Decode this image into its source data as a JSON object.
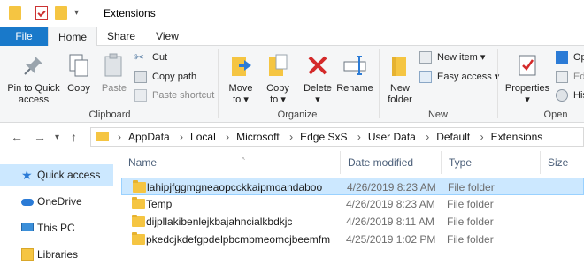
{
  "window": {
    "title": "Extensions"
  },
  "tabs": {
    "file": "File",
    "home": "Home",
    "share": "Share",
    "view": "View"
  },
  "ribbon": {
    "clipboard": {
      "pin": [
        "Pin to Quick",
        "access"
      ],
      "copy": "Copy",
      "paste": "Paste",
      "cut": "Cut",
      "copy_path": "Copy path",
      "paste_shortcut": "Paste shortcut",
      "group": "Clipboard"
    },
    "organize": {
      "move_to": [
        "Move",
        "to ▾"
      ],
      "copy_to": [
        "Copy",
        "to ▾"
      ],
      "delete": [
        "Delete",
        "▾"
      ],
      "rename": "Rename",
      "group": "Organize"
    },
    "new": {
      "new_folder": [
        "New",
        "folder"
      ],
      "new_item": "New item ▾",
      "easy_access": "Easy access ▾",
      "group": "New"
    },
    "open": {
      "properties": [
        "Properties",
        "▾"
      ],
      "open": "Op",
      "edit": "Edi",
      "history": "His",
      "group": "Open"
    }
  },
  "address": {
    "crumbs": [
      "AppData",
      "Local",
      "Microsoft",
      "Edge SxS",
      "User Data",
      "Default",
      "Extensions"
    ]
  },
  "nav": {
    "items": [
      "Quick access",
      "OneDrive",
      "This PC",
      "Libraries"
    ]
  },
  "columns": {
    "name": "Name",
    "date": "Date modified",
    "type": "Type",
    "size": "Size"
  },
  "files": [
    {
      "name": "lahipjfggmgneaopcckkaipmoandaboo",
      "date": "4/26/2019 8:23 AM",
      "type": "File folder"
    },
    {
      "name": "Temp",
      "date": "4/26/2019 8:23 AM",
      "type": "File folder"
    },
    {
      "name": "dijpllakibenlejkbajahncialkbdkjc",
      "date": "4/26/2019 8:11 AM",
      "type": "File folder"
    },
    {
      "name": "pkedcjkdefgpdelpbcmbmeomcjbeemfm",
      "date": "4/25/2019 1:02 PM",
      "type": "File folder"
    }
  ],
  "colors": {
    "accent": "#1979ca",
    "selection": "#cce8ff",
    "folder": "#f5c542"
  }
}
